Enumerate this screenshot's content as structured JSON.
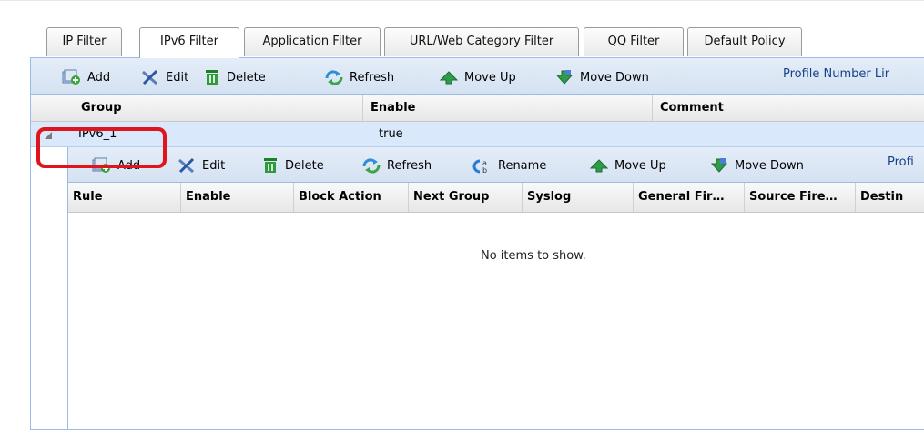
{
  "tabs": [
    {
      "label": "IP Filter",
      "active": false
    },
    {
      "label": "IPv6 Filter",
      "active": true
    },
    {
      "label": "Application Filter",
      "active": false
    },
    {
      "label": "URL/Web Category Filter",
      "active": false
    },
    {
      "label": "QQ Filter",
      "active": false
    },
    {
      "label": "Default Policy",
      "active": false
    }
  ],
  "toolbar": {
    "add": "Add",
    "edit": "Edit",
    "delete": "Delete",
    "refresh": "Refresh",
    "move_up": "Move Up",
    "move_down": "Move Down",
    "profile_link": "Profile Number Lir"
  },
  "group_table": {
    "columns": [
      "Group",
      "Enable",
      "Comment"
    ],
    "rows": [
      {
        "group": "IPv6_1",
        "enable": "true",
        "comment": ""
      }
    ]
  },
  "rule_toolbar": {
    "add": "Add",
    "edit": "Edit",
    "delete": "Delete",
    "refresh": "Refresh",
    "rename": "Rename",
    "move_up": "Move Up",
    "move_down": "Move Down",
    "profile_link": "Profi"
  },
  "rule_table": {
    "columns": [
      "Rule",
      "Enable",
      "Block Action",
      "Next Group",
      "Syslog",
      "General Fir…",
      "Source Fire…",
      "Destin"
    ],
    "empty_text": "No items to show."
  },
  "colors": {
    "toolbar_bg": "#d9e5f4",
    "selected_row": "#d9e8fb",
    "highlight_box": "#e0141c",
    "panel_border": "#99bbe8"
  }
}
